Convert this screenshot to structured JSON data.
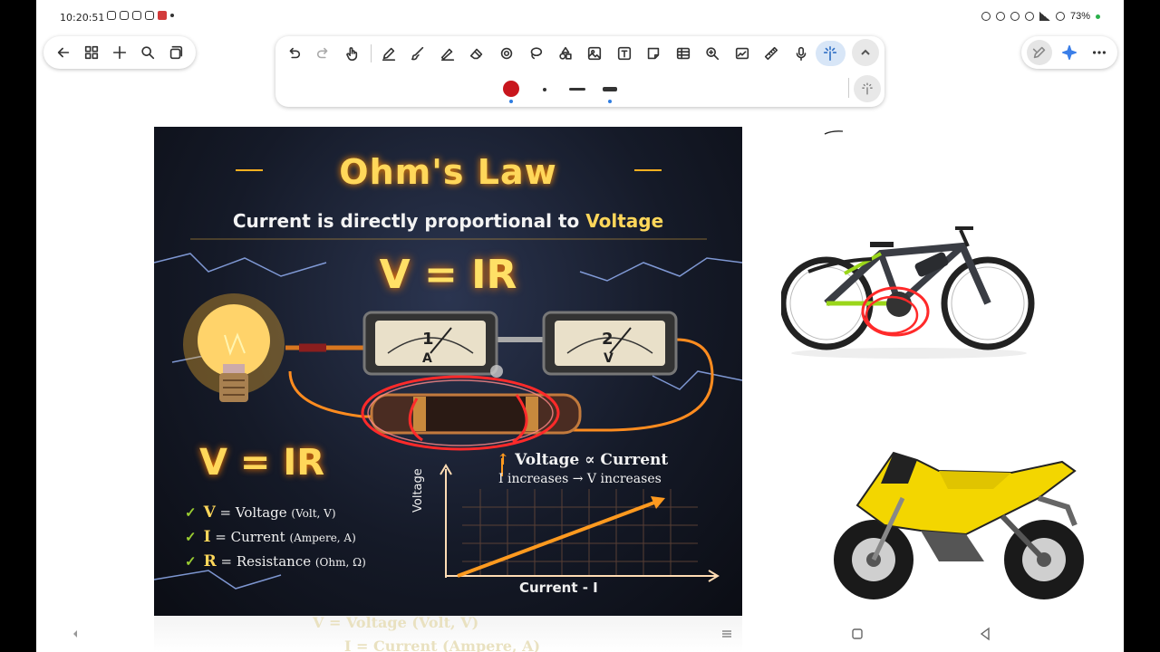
{
  "status_bar": {
    "time": "10:20:51",
    "battery": "73%"
  },
  "nav_pill": {
    "icons": [
      "back-arrow-icon",
      "grid-icon",
      "plus-icon",
      "search-icon",
      "copy-icon"
    ]
  },
  "toolbar": {
    "icons": [
      "undo-icon",
      "redo-icon",
      "hand-select-icon",
      "pen-icon",
      "brush-icon",
      "highlighter-icon",
      "eraser-icon",
      "lasso-select-icon",
      "shape-lasso-icon",
      "shapes-icon",
      "image-icon",
      "text-box-icon",
      "sticky-note-icon",
      "table-icon",
      "zoom-icon",
      "chart-icon",
      "ruler-icon",
      "microphone-icon",
      "laser-pointer-icon",
      "collapse-icon"
    ],
    "pen_color": "#c8161d",
    "accent": "#2f7de1"
  },
  "right_pill": {
    "icons": [
      "pen-mode-icon",
      "ai-sparkle-icon",
      "more-icon"
    ]
  },
  "poster": {
    "title": "Ohm's Law",
    "subtitle_prefix": "Current is directly proportional to ",
    "subtitle_highlight": "Voltage",
    "equation_top": "V = IR",
    "equation_left": "V = IR",
    "meter_1_number": "1",
    "meter_1_unit": "A",
    "meter_2_number": "2",
    "meter_2_unit": "V",
    "proportional": "Voltage ∝ Current",
    "increases": "I increases → V increases",
    "legend": [
      {
        "key": "V",
        "text": " = Voltage ",
        "small": "(Volt, V)"
      },
      {
        "key": "I",
        "text": " = Current ",
        "small": "(Ampere, A)"
      },
      {
        "key": "R",
        "text": " = Resistance ",
        "small": "(Ohm, Ω)"
      }
    ],
    "graph_ylabel": "Voltage",
    "graph_xlabel": "Current - I"
  },
  "poster_ghost": {
    "line1": "V = Voltage (Volt, V)",
    "line2": "I = Current (Ampere, A)"
  }
}
